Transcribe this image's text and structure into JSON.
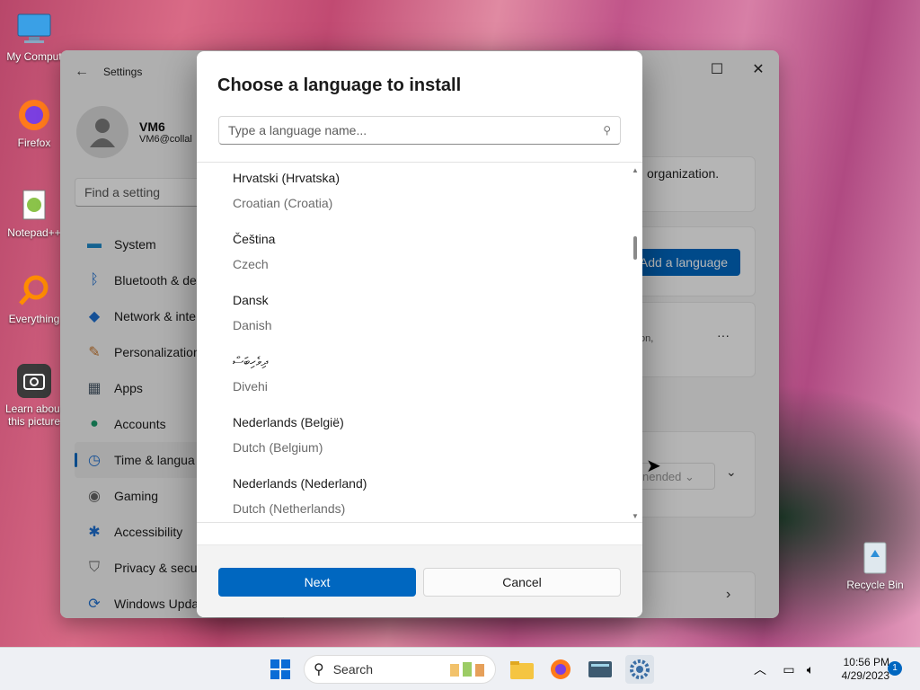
{
  "desktop": {
    "icons": [
      {
        "label": "My Comput"
      },
      {
        "label": "Firefox"
      },
      {
        "label": "Notepad++"
      },
      {
        "label": "Everything"
      },
      {
        "label": "Learn about this picture"
      },
      {
        "label": "Recycle Bin"
      }
    ]
  },
  "settings_window": {
    "title": "Settings",
    "user_name": "VM6",
    "user_email": "VM6@collal",
    "search_placeholder": "Find a setting",
    "nav": [
      {
        "label": "System",
        "icon": "monitor-icon"
      },
      {
        "label": "Bluetooth & de",
        "icon": "bluetooth-icon"
      },
      {
        "label": "Network & inte",
        "icon": "wifi-icon"
      },
      {
        "label": "Personalization",
        "icon": "brush-icon"
      },
      {
        "label": "Apps",
        "icon": "apps-icon"
      },
      {
        "label": "Accounts",
        "icon": "person-icon"
      },
      {
        "label": "Time & langua",
        "icon": "clock-globe-icon",
        "active": true
      },
      {
        "label": "Gaming",
        "icon": "gamepad-icon"
      },
      {
        "label": "Accessibility",
        "icon": "accessibility-icon"
      },
      {
        "label": "Privacy & secu",
        "icon": "shield-icon"
      },
      {
        "label": "Windows Upda",
        "icon": "update-icon"
      }
    ],
    "org_text": "organization.",
    "add_language_label": "Add a language",
    "partial_text_1": "on,",
    "recommended_partial": "nended",
    "more_label": "···"
  },
  "dialog": {
    "title": "Choose a language to install",
    "search_placeholder": "Type a language name...",
    "languages": [
      {
        "native": "Hrvatski (Hrvatska)",
        "english": "Croatian (Croatia)"
      },
      {
        "native": "Čeština",
        "english": "Czech"
      },
      {
        "native": "Dansk",
        "english": "Danish"
      },
      {
        "native": "ދިވެހިބަސް",
        "english": "Divehi"
      },
      {
        "native": "Nederlands (België)",
        "english": "Dutch (Belgium)"
      },
      {
        "native": "Nederlands (Nederland)",
        "english": "Dutch (Netherlands)"
      }
    ],
    "next_label": "Next",
    "cancel_label": "Cancel",
    "colors": {
      "accent": "#0067c0"
    }
  },
  "taskbar": {
    "search_label": "Search",
    "time": "10:56 PM",
    "date": "4/29/2023",
    "notification_count": "1"
  }
}
